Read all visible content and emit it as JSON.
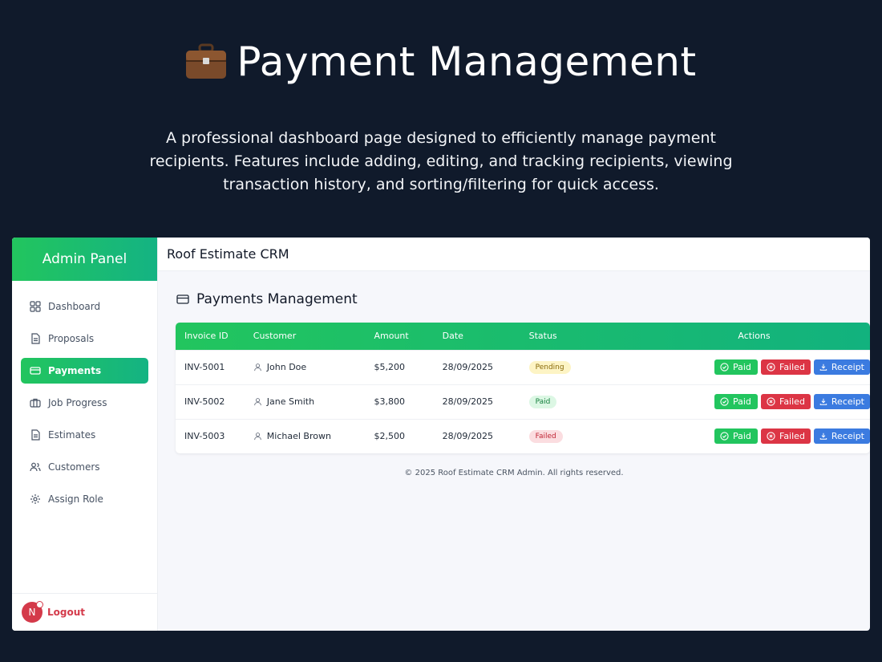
{
  "hero": {
    "title": "Payment Management",
    "description": "A professional dashboard page designed to efficiently manage payment recipients. Features include adding, editing, and tracking recipients, viewing transaction history, and sorting/filtering for quick access."
  },
  "sidebar": {
    "title": "Admin Panel",
    "items": [
      {
        "label": "Dashboard",
        "icon": "grid-icon"
      },
      {
        "label": "Proposals",
        "icon": "document-icon"
      },
      {
        "label": "Payments",
        "icon": "credit-card-icon",
        "active": true
      },
      {
        "label": "Job Progress",
        "icon": "briefcase-icon"
      },
      {
        "label": "Estimates",
        "icon": "document-icon"
      },
      {
        "label": "Customers",
        "icon": "users-icon"
      },
      {
        "label": "Assign Role",
        "icon": "gear-icon"
      }
    ],
    "logout": {
      "avatar_letter": "N",
      "label": "Logout"
    }
  },
  "topbar": {
    "title": "Roof Estimate CRM"
  },
  "section": {
    "title": "Payments Management"
  },
  "table": {
    "headers": [
      "Invoice ID",
      "Customer",
      "Amount",
      "Date",
      "Status",
      "Actions"
    ],
    "rows": [
      {
        "invoice": "INV-5001",
        "customer": "John Doe",
        "amount": "$5,200",
        "date": "28/09/2025",
        "status": "Pending"
      },
      {
        "invoice": "INV-5002",
        "customer": "Jane Smith",
        "amount": "$3,800",
        "date": "28/09/2025",
        "status": "Paid"
      },
      {
        "invoice": "INV-5003",
        "customer": "Michael Brown",
        "amount": "$2,500",
        "date": "28/09/2025",
        "status": "Failed"
      }
    ],
    "action_labels": {
      "paid": "Paid",
      "failed": "Failed",
      "receipt": "Receipt"
    }
  },
  "footer": "© 2025 Roof Estimate CRM Admin. All rights reserved.",
  "colors": {
    "background": "#101a2b",
    "accent_green": "#22c55e",
    "danger_red": "#dc3545",
    "receipt_blue": "#3b7be0"
  }
}
